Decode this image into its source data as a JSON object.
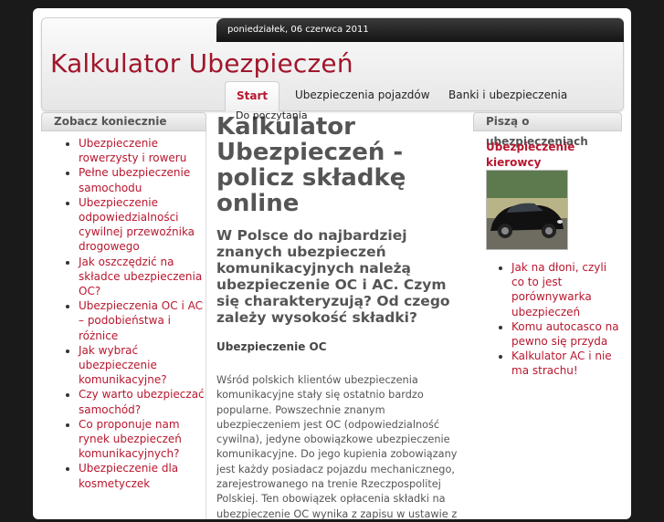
{
  "header": {
    "date": "poniedziałek, 06 czerwca 2011",
    "logo": "Kalkulator Ubezpieczeń"
  },
  "nav": {
    "items": [
      {
        "label": "Start"
      },
      {
        "label": "Ubezpieczenia pojazdów"
      },
      {
        "label": "Banki i ubezpieczenia"
      }
    ],
    "sub_item": "Do poczytania"
  },
  "sidebar_left": {
    "title": "Zobacz koniecznie",
    "items": [
      "Ubezpieczenie rowerzysty i roweru",
      "Pełne ubezpieczenie samochodu",
      "Ubezpieczenie odpowiedzialności cywilnej przewoźnika drogowego",
      "Jak oszczędzić na składce ubezpieczenia OC?",
      "Ubezpieczenia OC i AC – podobieństwa i różnice",
      "Jak wybrać ubezpieczenie komunikacyjne?",
      "Czy warto ubezpieczać samochód?",
      "Co proponuje nam rynek ubezpieczeń komunikacyjnych?",
      "Ubezpieczenie dla kosmetyczek"
    ]
  },
  "content": {
    "title": "Kalkulator Ubezpieczeń - policz składkę online",
    "subtitle": "W Polsce do najbardziej znanych ubezpieczeń komunikacyjnych należą ubezpieczenie OC i AC. Czym się charakteryzują? Od czego zależy wysokość składki?",
    "section_heading": "Ubezpieczenie OC",
    "paragraph": "Wśród polskich klientów ubezpieczenia komunikacyjne stały się ostatnio bardzo popularne. Powszechnie znanym ubezpieczeniem jest OC  (odpowiedzialność cywilna), jedyne obowiązkowe ubezpieczenie komunikacyjne. Do jego kupienia zobowiązany jest każdy posiadacz pojazdu mechanicznego, zarejestrowanego na trenie Rzeczpospolitej Polskiej. Ten obowiązek opłacenia składki na ubezpieczenie OC wynika z zapisu w ustawie z"
  },
  "sidebar_right": {
    "title": "Piszą o",
    "heading": "ubezpieczeniach",
    "feature": "Ubezpieczenie kierowcy",
    "items": [
      "Jak na dłoni, czyli co to jest porównywarka ubezpieczeń",
      "Komu autocasco na pewno się przyda",
      "Kalkulator AC i nie ma strachu!"
    ]
  },
  "colors": {
    "accent": "#b8172f",
    "background": "#1a1a1a"
  }
}
